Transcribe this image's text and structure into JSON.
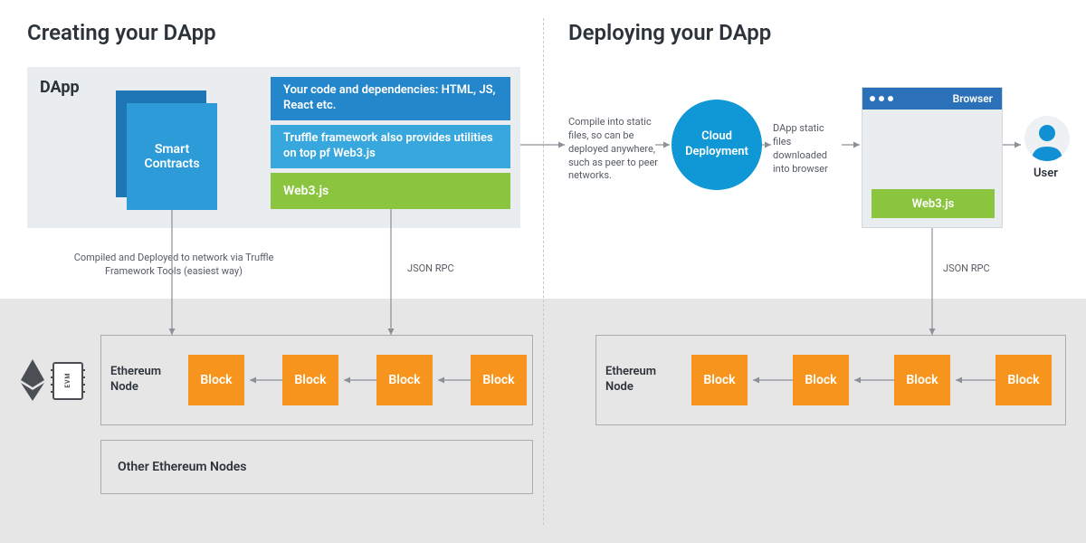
{
  "left": {
    "title": "Creating your DApp",
    "dapp_label": "DApp",
    "smart_contracts": "Smart Contracts",
    "code_box": "Your code and dependencies: HTML, JS, React etc.",
    "truffle_box": "Truffle framework also provides utilities on top pf Web3.js",
    "web3_box": "Web3.js",
    "compiled_note": "Compiled and Deployed to network via Truffle Framework Tools (easiest way)",
    "json_rpc": "JSON RPC",
    "eth_node": "Ethereum Node",
    "block": "Block",
    "other_nodes": "Other Ethereum Nodes"
  },
  "right": {
    "title": "Deploying your DApp",
    "compile_note": "Compile into static files, so can be deployed anywhere, such as peer to peer networks.",
    "cloud": "Cloud Deployment",
    "dl_note": "DApp static files downloaded into browser",
    "browser": "Browser",
    "web3_box": "Web3.js",
    "user": "User",
    "json_rpc": "JSON RPC",
    "eth_node": "Ethereum Node",
    "block": "Block"
  },
  "colors": {
    "panel_grey": "#e9edef",
    "dark_blue": "#2587cb",
    "mid_blue": "#38a7dd",
    "green": "#8bc53f",
    "orange": "#f7941d",
    "circle_blue": "#1098d6",
    "browser_bar": "#2a71b9",
    "user_blue": "#1190d4",
    "bottom_grey": "#e6e6e6",
    "line": "#8a9096"
  }
}
